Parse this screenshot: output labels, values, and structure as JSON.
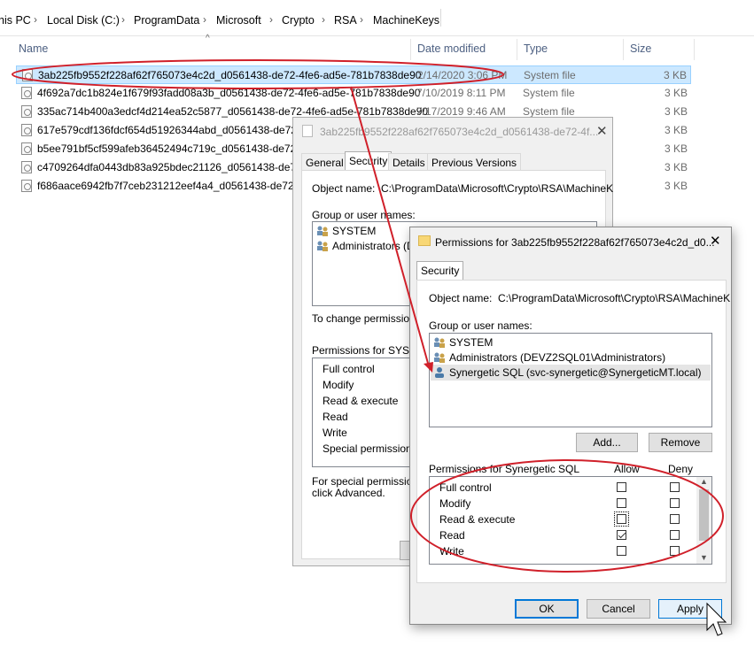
{
  "breadcrumb": [
    "his PC",
    "Local Disk (C:)",
    "ProgramData",
    "Microsoft",
    "Crypto",
    "RSA",
    "MachineKeys"
  ],
  "columns": {
    "name": "Name",
    "date": "Date modified",
    "type": "Type",
    "size": "Size"
  },
  "files": [
    {
      "name": "3ab225fb9552f228af62f765073e4c2d_d0561438-de72-4fe6-ad5e-781b7838de90",
      "date": "2/14/2020 3:06 PM",
      "type": "System file",
      "size": "3 KB"
    },
    {
      "name": "4f692a7dc1b824e1f679f93fadd08a3b_d0561438-de72-4fe6-ad5e-781b7838de90",
      "date": "7/10/2019 8:11 PM",
      "type": "System file",
      "size": "3 KB"
    },
    {
      "name": "335ac714b400a3edcf4d214ea52c5877_d0561438-de72-4fe6-ad5e-781b7838de90",
      "date": "7/17/2019 9:46 AM",
      "type": "System file",
      "size": "3 KB"
    },
    {
      "name": "617e579cdf136fdcf654d51926344abd_d0561438-de72-4f",
      "date": "",
      "type": "",
      "size": "3 KB"
    },
    {
      "name": "b5ee791bf5cf599afeb36452494c719c_d0561438-de72-4f",
      "date": "",
      "type": "",
      "size": "3 KB"
    },
    {
      "name": "c4709264dfa0443db83a925bdec21126_d0561438-de72-4",
      "date": "",
      "type": "",
      "size": "3 KB"
    },
    {
      "name": "f686aace6942fb7f7ceb231212eef4a4_d0561438-de72-4fe",
      "date": "",
      "type": "",
      "size": "3 KB"
    }
  ],
  "props": {
    "title": "3ab225fb9552f228af62f765073e4c2d_d0561438-de72-4f...",
    "tabs": [
      "General",
      "Security",
      "Details",
      "Previous Versions"
    ],
    "object_label": "Object name:",
    "object_value": "C:\\ProgramData\\Microsoft\\Crypto\\RSA\\MachineK",
    "group_label": "Group or user names:",
    "users": [
      "SYSTEM",
      "Administrators (DEV"
    ],
    "change_text": "To change permissions",
    "perms_for": "Permissions for SYSTE",
    "perms": [
      "Full control",
      "Modify",
      "Read & execute",
      "Read",
      "Write",
      "Special permissions"
    ],
    "special_text_1": "For special permissions",
    "special_text_2": "click Advanced."
  },
  "perm": {
    "title": "Permissions for 3ab225fb9552f228af62f765073e4c2d_d0...",
    "close": "✕",
    "tab": "Security",
    "object_label": "Object name:",
    "object_value": "C:\\ProgramData\\Microsoft\\Crypto\\RSA\\MachineK",
    "group_label": "Group or user names:",
    "users": [
      "SYSTEM",
      "Administrators (DEVZ2SQL01\\Administrators)",
      "Synergetic SQL (svc-synergetic@SynergeticMT.local)"
    ],
    "add": "Add...",
    "remove": "Remove",
    "perms_for": "Permissions for Synergetic SQL",
    "allow": "Allow",
    "deny": "Deny",
    "perms": [
      {
        "name": "Full control",
        "allow": false,
        "deny": false
      },
      {
        "name": "Modify",
        "allow": false,
        "deny": false
      },
      {
        "name": "Read & execute",
        "allow": false,
        "deny": false
      },
      {
        "name": "Read",
        "allow": true,
        "deny": false
      },
      {
        "name": "Write",
        "allow": false,
        "deny": false
      }
    ],
    "ok": "OK",
    "cancel": "Cancel",
    "apply": "Apply"
  },
  "colors": {
    "annotation": "#d0202a",
    "selection": "#cce8ff",
    "accent": "#0078d7"
  }
}
